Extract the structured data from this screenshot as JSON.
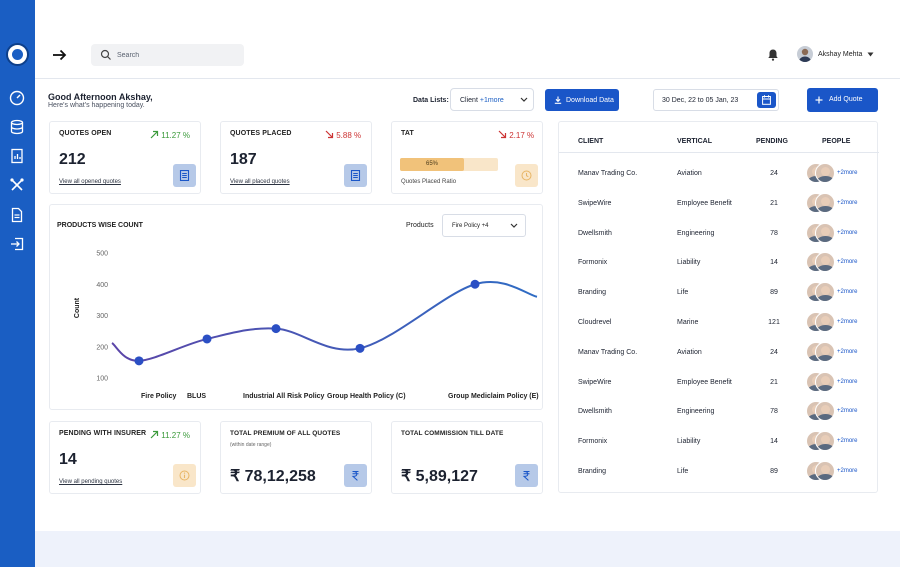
{
  "header": {
    "search_placeholder": "Search",
    "user_name": "Akshay Mehta"
  },
  "greeting": {
    "title": "Good Afternoon Akshay,",
    "subtitle": "Here's what's happening today."
  },
  "toolbar": {
    "data_lists_label": "Data Lists:",
    "client_value": "Client",
    "client_more": "+1more",
    "download_label": "Download Data",
    "date_range": "30 Dec, 22 to 05 Jan, 23",
    "add_quote_label": "Add Quote"
  },
  "cards": {
    "quotes_open": {
      "title": "QUOTES OPEN",
      "trend": "11.27 %",
      "value": "212",
      "link": "View all opened quotes"
    },
    "quotes_placed": {
      "title": "QUOTES PLACED",
      "trend": "5.88 %",
      "value": "187",
      "link": "View all placed quotes"
    },
    "tat": {
      "title": "TAT",
      "trend": "2.17 %",
      "bar_label": "65%",
      "bar_fraction": 0.65,
      "caption": "Quotes Placed Ratio"
    },
    "pending": {
      "title": "PENDING WITH INSURER",
      "trend": "11.27 %",
      "value": "14",
      "link": "View all pending quotes"
    },
    "total_premium": {
      "title": "TOTAL PREMIUM OF ALL QUOTES",
      "subtitle": "(within date range)",
      "value": "₹ 78,12,258"
    },
    "total_commission": {
      "title": "TOTAL COMMISSION TILL DATE",
      "value": "₹ 5,89,127"
    }
  },
  "chart_section": {
    "products_label": "Products",
    "products_value": "Fire Policy +4"
  },
  "chart_data": {
    "type": "line",
    "title": "PRODUCTS WISE COUNT",
    "ylabel": "Count",
    "xlabel": "",
    "categories": [
      "Fire Policy",
      "BLUS",
      "Industrial All Risk Policy",
      "Group Health Policy (C)",
      "Group Mediclaim Policy (E)"
    ],
    "values": [
      155,
      225,
      258,
      195,
      400
    ],
    "yticks": [
      100,
      200,
      300,
      400,
      500
    ],
    "ylim": [
      100,
      500
    ],
    "grid": false,
    "colors": {
      "line_start": "#5b45a8",
      "line_end": "#2f6cc4",
      "marker": "#2b4fc4"
    }
  },
  "table": {
    "headers": {
      "client": "CLIENT",
      "vertical": "VERTICAL",
      "pending": "PENDING",
      "people": "PEOPLE"
    },
    "more_label": "+2more",
    "rows": [
      {
        "client": "Manav Trading Co.",
        "vertical": "Aviation",
        "pending": "24"
      },
      {
        "client": "SwipeWire",
        "vertical": "Employee Benefit",
        "pending": "21"
      },
      {
        "client": "Dwellsmith",
        "vertical": "Engineering",
        "pending": "78"
      },
      {
        "client": "Formonix",
        "vertical": "Liability",
        "pending": "14"
      },
      {
        "client": "Branding",
        "vertical": "Life",
        "pending": "89"
      },
      {
        "client": "Cloudrevel",
        "vertical": "Marine",
        "pending": "121"
      },
      {
        "client": "Manav Trading Co.",
        "vertical": "Aviation",
        "pending": "24"
      },
      {
        "client": "SwipeWire",
        "vertical": "Employee Benefit",
        "pending": "21"
      },
      {
        "client": "Dwellsmith",
        "vertical": "Engineering",
        "pending": "78"
      },
      {
        "client": "Formonix",
        "vertical": "Liability",
        "pending": "14"
      },
      {
        "client": "Branding",
        "vertical": "Life",
        "pending": "89"
      }
    ]
  },
  "colors": {
    "sidebar": "#1a5ec3",
    "primary_button": "#1a56c8",
    "trend_up": "#3a9a3a",
    "trend_down": "#cc3333",
    "tat_bar_fill": "#f1c27a",
    "tat_bar_track": "#f9e6c9"
  }
}
